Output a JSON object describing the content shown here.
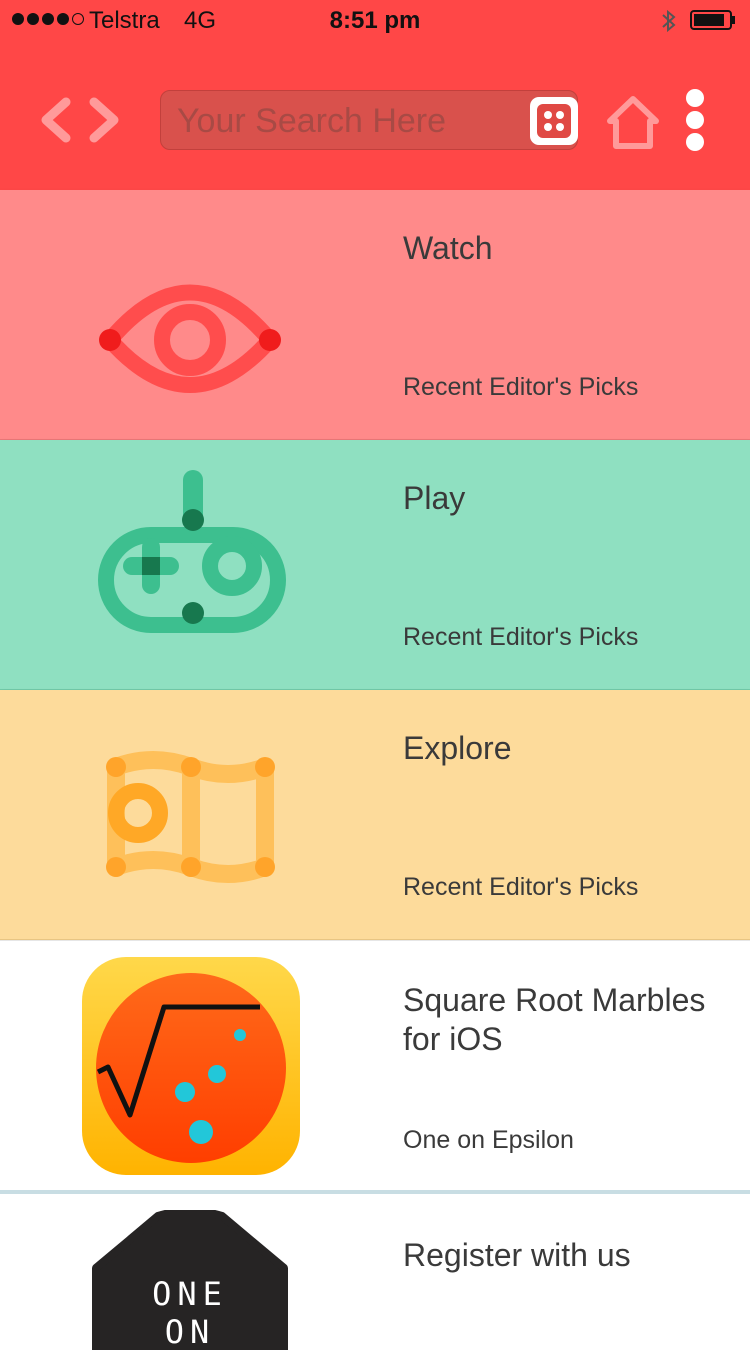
{
  "status_bar": {
    "carrier": "Telstra",
    "network": "4G",
    "time": "8:51 pm"
  },
  "toolbar": {
    "search_placeholder": "Your Search Here"
  },
  "categories": [
    {
      "title": "Watch",
      "subtitle": "Recent Editor's Picks",
      "color": "#ff8a8a",
      "icon": "eye-icon"
    },
    {
      "title": "Play",
      "subtitle": "Recent Editor's Picks",
      "color": "#8fe0c1",
      "icon": "gamepad-icon"
    },
    {
      "title": "Explore",
      "subtitle": "Recent Editor's Picks",
      "color": "#fddb9b",
      "icon": "map-icon"
    }
  ],
  "apps": [
    {
      "title": "Square Root Marbles for iOS",
      "subtitle": "One on Epsilon",
      "icon": "square-root-marbles-app-icon"
    },
    {
      "title": "Register with us",
      "logo_line1": "ONE",
      "logo_line2": "ON",
      "icon": "one-on-epsilon-logo"
    }
  ],
  "colors": {
    "header": "#ff4747",
    "text": "#3a3a3a"
  }
}
